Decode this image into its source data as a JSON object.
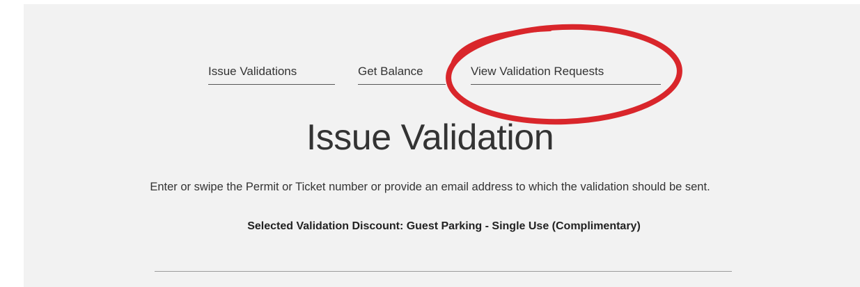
{
  "nav": {
    "issue_validations": "Issue Validations",
    "get_balance": "Get Balance",
    "view_validation_requests": "View Validation Requests"
  },
  "main": {
    "title": "Issue Validation",
    "instructions": "Enter or swipe the Permit or Ticket number or provide an email address to which the validation should be sent.",
    "selected_discount": "Selected Validation Discount: Guest Parking - Single Use (Complimentary)"
  },
  "colors": {
    "highlight_ring": "#d9262b",
    "panel_background": "#f2f2f2",
    "text": "#333333"
  }
}
